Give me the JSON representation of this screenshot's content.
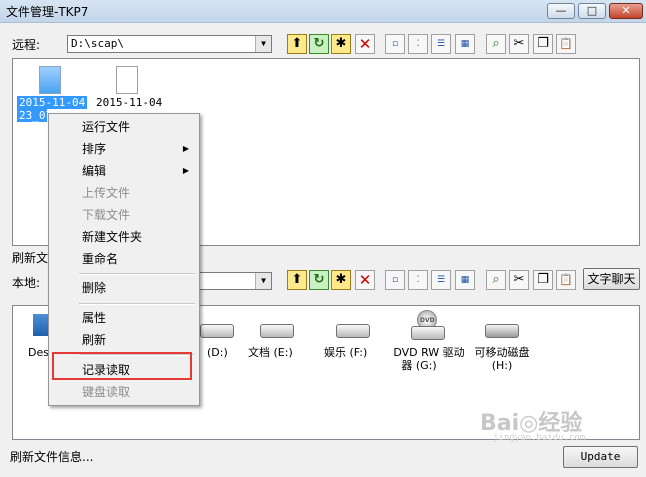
{
  "window": {
    "title": "文件管理-TKP7",
    "minimize": "—",
    "maximize": "□",
    "close": "✕"
  },
  "remote": {
    "label": "远程:",
    "path": "D:\\scap\\",
    "files": [
      {
        "line1": "2015-11-04",
        "line2": "23_07"
      },
      {
        "line1": "2015-11-04",
        "line2": ""
      }
    ],
    "status": "刷新文"
  },
  "toolbar": {
    "icons": [
      "folder-up-icon",
      "refresh-icon",
      "new-folder-icon",
      "delete-icon",
      "large-icons-view-icon",
      "small-icons-view-icon",
      "list-view-icon",
      "details-view-icon",
      "search-icon",
      "cut-icon",
      "copy-icon",
      "paste-icon"
    ],
    "glyphs": [
      "⬆",
      "↻",
      "✱",
      "✕",
      "▫",
      "⁚",
      "☰",
      "▦",
      "⌕",
      "✂",
      "❐",
      "📋"
    ]
  },
  "local": {
    "label": "本地:",
    "chat_button": "文字聊天",
    "drives": [
      {
        "label": "Des"
      },
      {
        "label": "(D:)"
      },
      {
        "label": "文档 (E:)"
      },
      {
        "label": "娱乐 (F:)"
      },
      {
        "label": "DVD RW 驱动器 (G:)",
        "line1": "DVD RW 驱动",
        "line2": "器 (G:)"
      },
      {
        "label": "可移动磁盘 (H:)",
        "line1": "可移动磁盘",
        "line2": "(H:)"
      }
    ],
    "dvd_badge": "DVD"
  },
  "context_menu": {
    "items": [
      {
        "label": "运行文件",
        "enabled": true
      },
      {
        "label": "排序",
        "enabled": true,
        "submenu": true
      },
      {
        "label": "编辑",
        "enabled": true,
        "submenu": true
      },
      {
        "label": "上传文件",
        "enabled": false
      },
      {
        "label": "下载文件",
        "enabled": false
      },
      {
        "label": "新建文件夹",
        "enabled": true
      },
      {
        "label": "重命名",
        "enabled": true
      },
      {
        "label": "删除",
        "enabled": true
      },
      {
        "label": "属性",
        "enabled": true
      },
      {
        "label": "刷新",
        "enabled": true
      },
      {
        "label": "记录读取",
        "enabled": true,
        "highlighted": true
      },
      {
        "label": "键盘读取",
        "enabled": false
      }
    ],
    "highlight_color": "#e53935"
  },
  "status_bar": {
    "text": "刷新文件信息...",
    "update_button": "Update"
  },
  "watermark": {
    "brand": "Bai◎经验",
    "url": "jingyan.baidu.com"
  },
  "colors": {
    "selection": "#3399ff",
    "close_button": "#c2452d"
  }
}
